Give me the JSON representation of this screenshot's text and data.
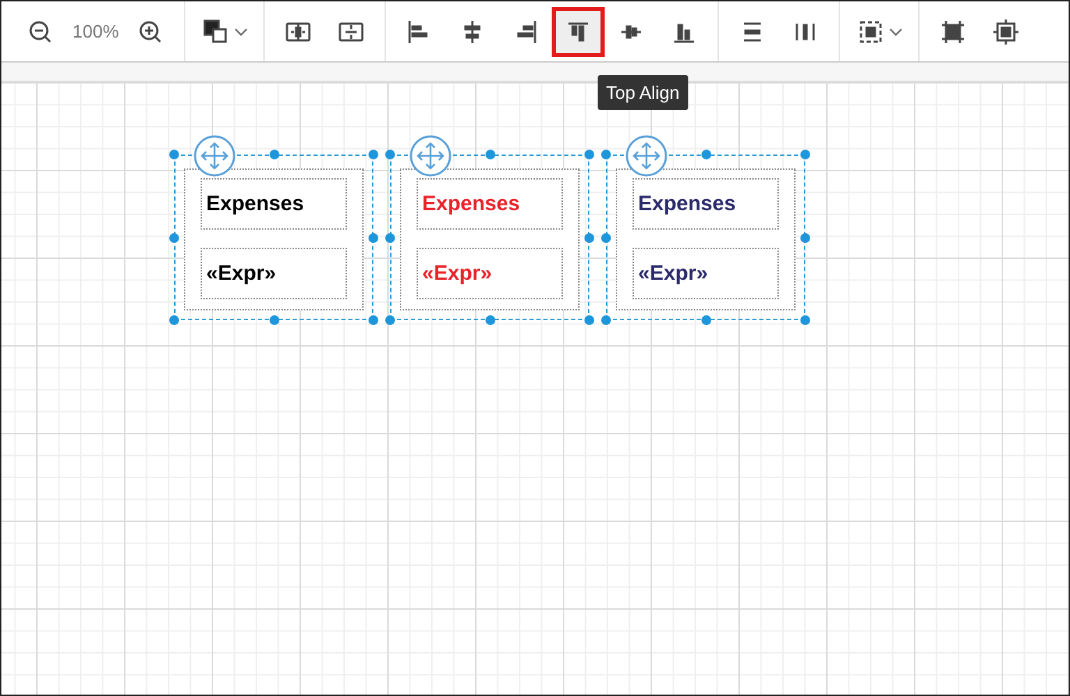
{
  "toolbar": {
    "items": [
      {
        "kind": "button",
        "highlighted": false
      },
      {
        "kind": "text",
        "text": "100%"
      },
      {
        "kind": "button",
        "highlighted": false
      },
      {
        "kind": "separator"
      },
      {
        "kind": "dropdown",
        "highlighted": false
      },
      {
        "kind": "separator"
      },
      {
        "kind": "button",
        "highlighted": false
      },
      {
        "kind": "button",
        "highlighted": false
      },
      {
        "kind": "separator"
      },
      {
        "kind": "button",
        "highlighted": false
      },
      {
        "kind": "button",
        "highlighted": false
      },
      {
        "kind": "button",
        "highlighted": false
      },
      {
        "kind": "button",
        "highlighted": true
      },
      {
        "kind": "button",
        "highlighted": false
      },
      {
        "kind": "button",
        "highlighted": false
      },
      {
        "kind": "separator"
      },
      {
        "kind": "button",
        "highlighted": false
      },
      {
        "kind": "button",
        "highlighted": false
      },
      {
        "kind": "separator"
      },
      {
        "kind": "dropdown",
        "highlighted": false
      },
      {
        "kind": "separator"
      },
      {
        "kind": "button",
        "highlighted": false
      },
      {
        "kind": "button",
        "highlighted": false
      }
    ]
  },
  "tooltip": {
    "text": "Top Align"
  },
  "panels": [
    {
      "title": "Expenses",
      "expr": "«Expr»",
      "color": "#000000"
    },
    {
      "title": "Expenses",
      "expr": "«Expr»",
      "color": "#e8232a"
    },
    {
      "title": "Expenses",
      "expr": "«Expr»",
      "color": "#2b2a6b"
    }
  ]
}
